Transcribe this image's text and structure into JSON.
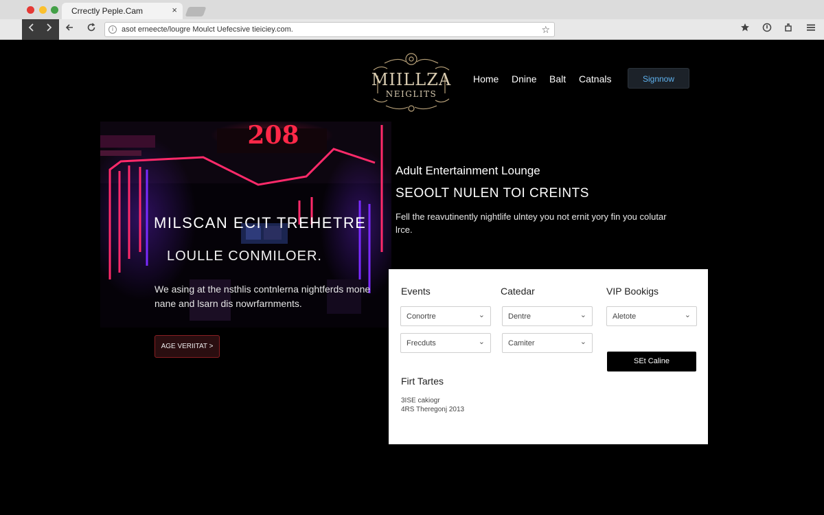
{
  "browser": {
    "tab_title": "Crrectly Peple.Cam",
    "tab_close": "×",
    "url": "asot erneecte/lougre Moulct Uefecsive tieiciey.com.",
    "url_info": "i",
    "bookmark": "☆"
  },
  "icons": {
    "back": "back-arrow-icon",
    "forward": "forward-arrow-icon",
    "reload": "reload-icon",
    "star": "star-icon",
    "shield": "shield-icon",
    "extension": "extension-icon",
    "menu": "hamburger-menu-icon"
  },
  "header": {
    "logo_line1": "MIILLZA",
    "logo_line2": "NEIGLITS",
    "nav": [
      "Home",
      "Dnine",
      "Balt",
      "Catnals"
    ],
    "signup_label": "Signnow"
  },
  "hero": {
    "neon_number": "208",
    "title": "MILSCAN ECIT TREHETRE",
    "subtitle": "LOULLE CONMILOER.",
    "description": "We asing at the nsthlis contnlerna nightferds mone nane and lsarn dis nowrfarnments.",
    "button_label": "AGE VERIITAT >"
  },
  "info": {
    "line1": "Adult Entertainment Lounge",
    "line2": "SEOOLT NULEN TOI CREINTS",
    "description": "Fell the reavutinently nightlife ulntey you not ernit yory fin you colutar lrce."
  },
  "panel": {
    "headers": [
      "Events",
      "Catedar",
      "VIP Bookigs"
    ],
    "dropdowns": {
      "events_1": "Conortre",
      "events_2": "Frecduts",
      "calendar_1": "Dentre",
      "calendar_2": "Camiter",
      "vip_1": "Aletote"
    },
    "set_button": "SEt Caline",
    "subheading": "Firt Tartes",
    "small_line1": "3ISE cakiogr",
    "small_line2": "4RS Theregonj 2013"
  },
  "colors": {
    "accent_blue": "#5fb2ee",
    "neon_red": "#ff2848",
    "neon_pink": "#ff2a6a",
    "neon_purple": "#7a2bff",
    "age_button_border": "#8a1f23",
    "logo_gold": "#d8cbb0"
  }
}
